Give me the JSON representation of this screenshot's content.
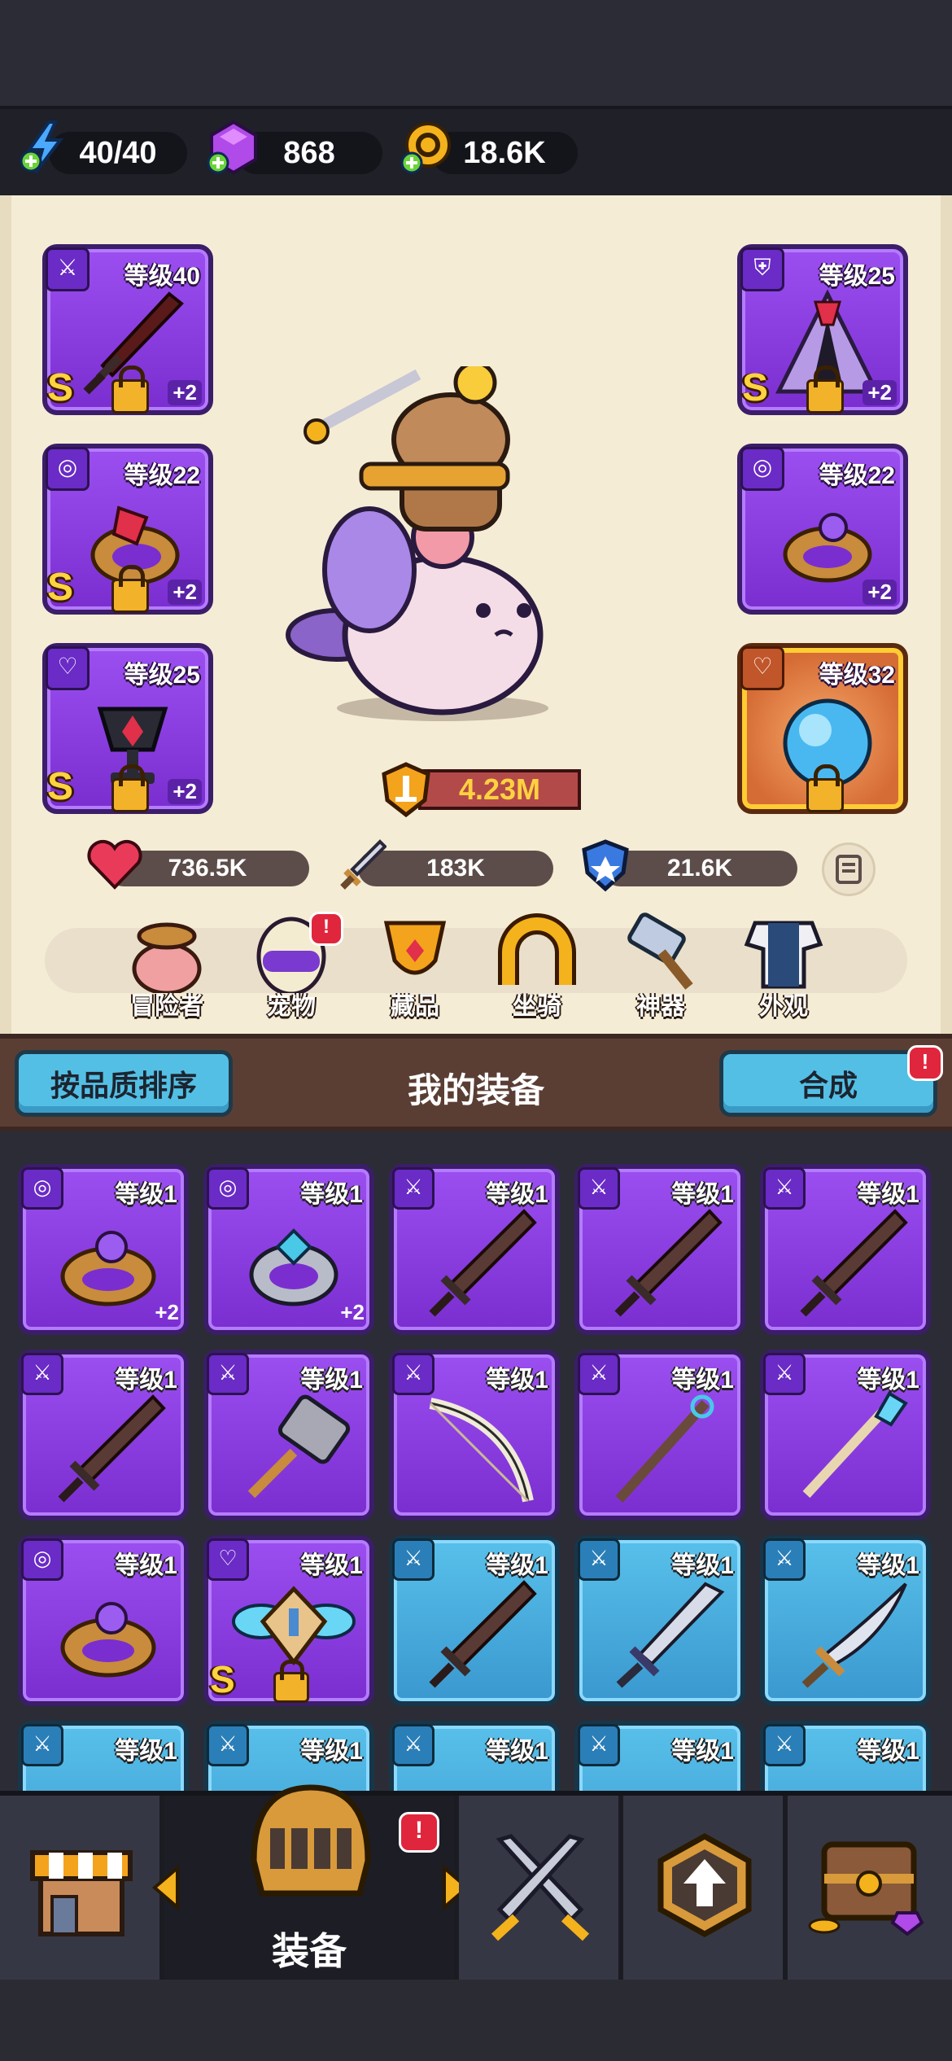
{
  "currency": {
    "energy": "40/40",
    "gems": "868",
    "gold": "18.6K"
  },
  "hero_slots": {
    "weapon": {
      "level": "等级40",
      "plus": "+2",
      "grade": "S"
    },
    "ring": {
      "level": "等级22",
      "plus": "+2",
      "grade": "S"
    },
    "necklace": {
      "level": "等级25",
      "plus": "+2",
      "grade": "S"
    },
    "armor": {
      "level": "等级25",
      "plus": "+2",
      "grade": "S"
    },
    "ring2": {
      "level": "等级22",
      "plus": "+2"
    },
    "relic": {
      "level": "等级32"
    }
  },
  "power": "4.23M",
  "stats": {
    "hp": "736.5K",
    "attack": "183K",
    "defense": "21.6K"
  },
  "nav": {
    "adventurer": "冒险者",
    "pet": "宠物",
    "collection": "藏品",
    "mount": "坐骑",
    "artifact": "神器",
    "appearance": "外观",
    "pet_badge": "!"
  },
  "equipment": {
    "sort_label": "按品质排序",
    "title": "我的装备",
    "merge_label": "合成",
    "merge_badge": "!"
  },
  "grid": {
    "r1": [
      {
        "level": "等级1",
        "plus": "+2"
      },
      {
        "level": "等级1",
        "plus": "+2"
      },
      {
        "level": "等级1"
      },
      {
        "level": "等级1"
      },
      {
        "level": "等级1"
      }
    ],
    "r2": [
      {
        "level": "等级1"
      },
      {
        "level": "等级1"
      },
      {
        "level": "等级1"
      },
      {
        "level": "等级1"
      },
      {
        "level": "等级1"
      }
    ],
    "r3": [
      {
        "level": "等级1"
      },
      {
        "level": "等级1",
        "grade": "S"
      },
      {
        "level": "等级1"
      },
      {
        "level": "等级1"
      },
      {
        "level": "等级1"
      }
    ],
    "r4": [
      {
        "level": "等级1"
      },
      {
        "level": "等级1"
      },
      {
        "level": "等级1"
      },
      {
        "level": "等级1"
      },
      {
        "level": "等级1"
      }
    ]
  },
  "bottom_nav": {
    "active_label": "装备",
    "badge": "!"
  }
}
